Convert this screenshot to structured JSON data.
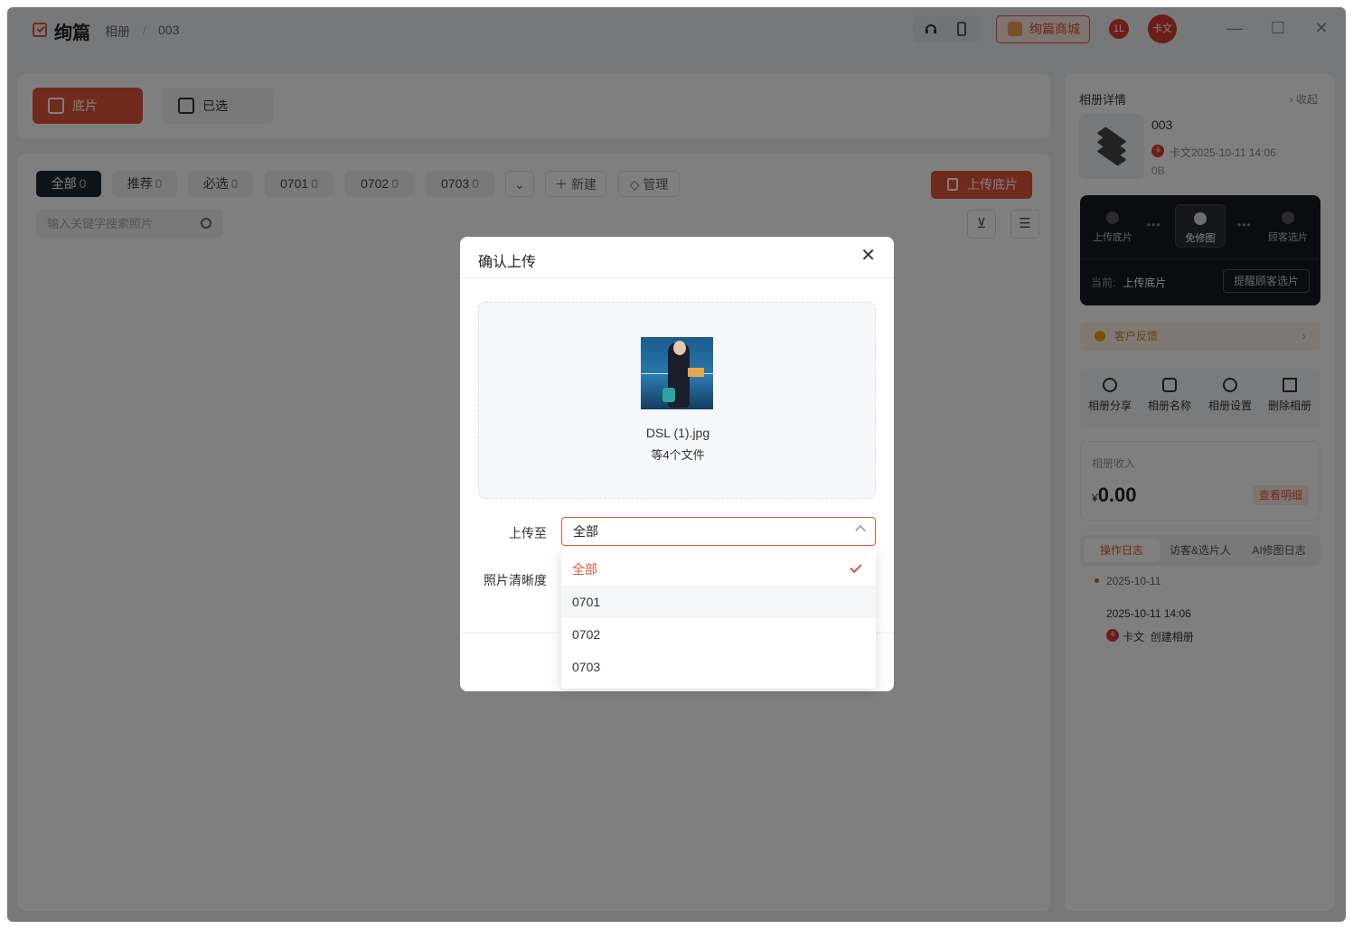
{
  "app": {
    "name": "绚篇"
  },
  "breadcrumb": [
    "相册",
    "003"
  ],
  "titlebar": {
    "shop_label": "绚篇商城",
    "badge_label": "1L",
    "avatar_label": "卡文",
    "minimize": "—",
    "maximize": "☐",
    "close": "✕"
  },
  "tabs": [
    {
      "label": "底片"
    },
    {
      "label": "已选"
    }
  ],
  "filters": [
    {
      "label": "全部",
      "count": "0"
    },
    {
      "label": "推荐",
      "count": "0"
    },
    {
      "label": "必选",
      "count": "0"
    },
    {
      "label": "0701",
      "count": "0"
    },
    {
      "label": "0702",
      "count": "0"
    },
    {
      "label": "0703",
      "count": "0"
    }
  ],
  "toolbar": {
    "new_label": "新建",
    "manage_label": "管理",
    "upload_label": "上传底片",
    "search_placeholder": "输入关键字搜索照片"
  },
  "sidebar": {
    "title": "相册详情",
    "collapse": "收起",
    "album_name": "003",
    "owner_datetime": "卡文2025-10-11 14:06",
    "size": "0B",
    "flow_steps": [
      "上传底片",
      "免修图",
      "顾客选片"
    ],
    "current_label": "当前:",
    "current_value": "上传底片",
    "remind_label": "提醒顾客选片",
    "feedback_label": "客户反馈",
    "actions": [
      "相册分享",
      "相册名称",
      "相册设置",
      "删除相册"
    ],
    "income_label": "相册收入",
    "income_currency": "¥",
    "income_value": "0.00",
    "income_detail": "查看明细",
    "log_tabs": [
      "操作日志",
      "访客&选片人",
      "AI修图日志"
    ],
    "log_date": "2025-10-11",
    "log_time": "2025-10-11 14:06",
    "log_user": "卡文",
    "log_action": "创建相册"
  },
  "modal": {
    "title": "确认上传",
    "file_name": "DSL (1).jpg",
    "file_more": "等4个文件",
    "upload_to_label": "上传至",
    "clarity_label": "照片清晰度",
    "selected_value": "全部",
    "options": [
      "全部",
      "0701",
      "0702",
      "0703"
    ]
  },
  "colors": {
    "accent": "#e0553b",
    "dark": "#141821"
  }
}
